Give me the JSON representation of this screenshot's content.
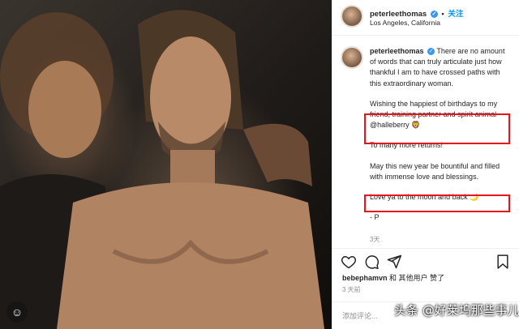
{
  "post": {
    "username": "peterleethomas",
    "follow_label": "关注",
    "location": "Los Angeles, California",
    "caption_paragraphs": [
      "There are no amount of words that can truly articulate just how thankful I am to have crossed paths with this extraordinary woman.",
      "Wishing the happiest of birthdays to my friend, training partner and spirit animal @halleberry 🦁",
      "To many more returns!",
      "May this new year be bountiful and filled with immense love and blessings.",
      "Love ya to the moon and back 🌙",
      "- P"
    ],
    "caption_time": "3天",
    "likes": {
      "user": "bebephamvn",
      "rest": "和 其他用户 赞了"
    },
    "time": "3 天前",
    "comment_placeholder": "添加评论...",
    "watermark": "头条 @好莱坞那些事儿"
  },
  "icons": {
    "verified": "verified-badge-icon",
    "heart": "heart-icon",
    "comment": "comment-icon",
    "share": "share-icon",
    "save": "bookmark-icon",
    "photo_badge": "user-tag-icon"
  },
  "colors": {
    "follow": "#0095f6",
    "highlight": "#e8141b",
    "verified": "#3897f0"
  }
}
